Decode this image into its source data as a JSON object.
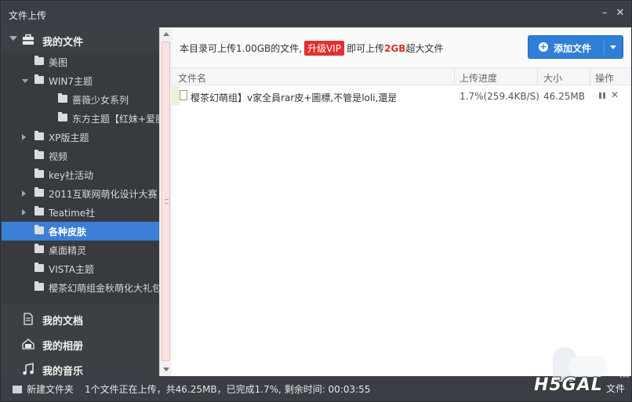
{
  "window": {
    "title": "文件上传"
  },
  "sidebar": {
    "my_files": "我的文件",
    "tree": [
      {
        "label": "美图",
        "level": 1,
        "expander": "none"
      },
      {
        "label": "WIN7主题",
        "level": 1,
        "expander": "open"
      },
      {
        "label": "蔷薇少女系列",
        "level": 2,
        "expander": "none"
      },
      {
        "label": "东方主题【红妹+爱丽丝",
        "level": 2,
        "expander": "none"
      },
      {
        "label": "XP版主题",
        "level": 1,
        "expander": "closed"
      },
      {
        "label": "视频",
        "level": 1,
        "expander": "none"
      },
      {
        "label": "key社活动",
        "level": 1,
        "expander": "none"
      },
      {
        "label": "2011互联网萌化设计大赛",
        "level": 1,
        "expander": "closed"
      },
      {
        "label": "Teatime社",
        "level": 1,
        "expander": "closed"
      },
      {
        "label": "各种皮肤",
        "level": 1,
        "expander": "none",
        "selected": true
      },
      {
        "label": "桌面精灵",
        "level": 1,
        "expander": "none"
      },
      {
        "label": "VISTA主题",
        "level": 1,
        "expander": "none"
      },
      {
        "label": "樱茶幻萌组金秋萌化大礼包",
        "level": 1,
        "expander": "none"
      }
    ],
    "my_docs": "我的文档",
    "my_photos": "我的相册",
    "my_music": "我的音乐"
  },
  "notice": {
    "prefix": "本目录可上传1.00GB的文件,",
    "vip": "升级VIP",
    "mid": "即可上传",
    "big": "2GB",
    "suffix": "超大文件"
  },
  "add_button": "添加文件",
  "table": {
    "headers": {
      "name": "文件名",
      "progress": "上传进度",
      "size": "大小",
      "action": "操作"
    },
    "rows": [
      {
        "name": "樱茶幻萌组】v家全員rar皮+圖標,不管是loli,還是正",
        "progress": "1.7%(259.4KB/S)",
        "size": "46.25MB"
      }
    ]
  },
  "status": {
    "new_folder": "新建文件夹",
    "text": "1个文件正在上传，共46.25MB，已完成1.7%, 剩余时间: 00:03:55"
  },
  "watermark": {
    "logo": "H5GAL",
    "tm": "TM",
    "tail": "文件"
  }
}
